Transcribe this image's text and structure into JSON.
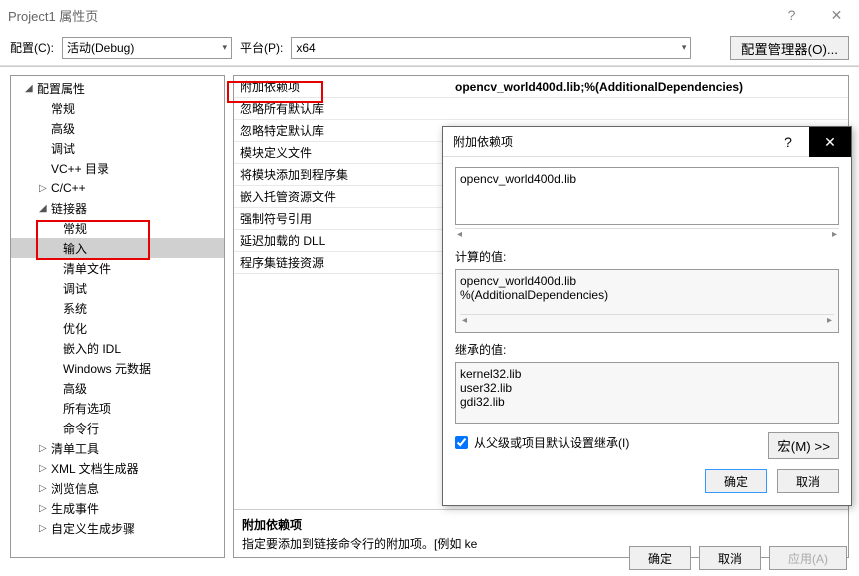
{
  "window": {
    "title": "Project1 属性页"
  },
  "toolbar": {
    "config_label": "配置(C):",
    "config_value": "活动(Debug)",
    "platform_label": "平台(P):",
    "platform_value": "x64",
    "config_mgr": "配置管理器(O)..."
  },
  "tree": {
    "root": "配置属性",
    "items": [
      "常规",
      "高级",
      "调试",
      "VC++ 目录",
      "C/C++",
      "链接器"
    ],
    "linker_children": [
      "常规",
      "输入",
      "清单文件",
      "调试",
      "系统",
      "优化",
      "嵌入的 IDL",
      "Windows 元数据",
      "高级",
      "所有选项",
      "命令行"
    ],
    "after": [
      "清单工具",
      "XML 文档生成器",
      "浏览信息",
      "生成事件",
      "自定义生成步骤"
    ]
  },
  "props": {
    "rows": [
      {
        "name": "附加依赖项",
        "val": "opencv_world400d.lib;%(AdditionalDependencies)"
      },
      {
        "name": "忽略所有默认库",
        "val": ""
      },
      {
        "name": "忽略特定默认库",
        "val": ""
      },
      {
        "name": "模块定义文件",
        "val": ""
      },
      {
        "name": "将模块添加到程序集",
        "val": ""
      },
      {
        "name": "嵌入托管资源文件",
        "val": ""
      },
      {
        "name": "强制符号引用",
        "val": ""
      },
      {
        "name": "延迟加载的 DLL",
        "val": ""
      },
      {
        "name": "程序集链接资源",
        "val": ""
      }
    ],
    "desc_title": "附加依赖项",
    "desc_text": "指定要添加到链接命令行的附加项。[例如 ke"
  },
  "modal": {
    "title": "附加依赖项",
    "input": "opencv_world400d.lib",
    "computed_label": "计算的值:",
    "computed_lines": [
      "opencv_world400d.lib",
      "%(AdditionalDependencies)"
    ],
    "inherited_label": "继承的值:",
    "inherited_lines": [
      "kernel32.lib",
      "user32.lib",
      "gdi32.lib"
    ],
    "inherit_chk": "从父级或项目默认设置继承(I)",
    "macro_btn": "宏(M) >>",
    "ok": "确定",
    "cancel": "取消"
  },
  "footer": {
    "ok": "确定",
    "cancel": "取消",
    "apply": "应用(A)"
  }
}
